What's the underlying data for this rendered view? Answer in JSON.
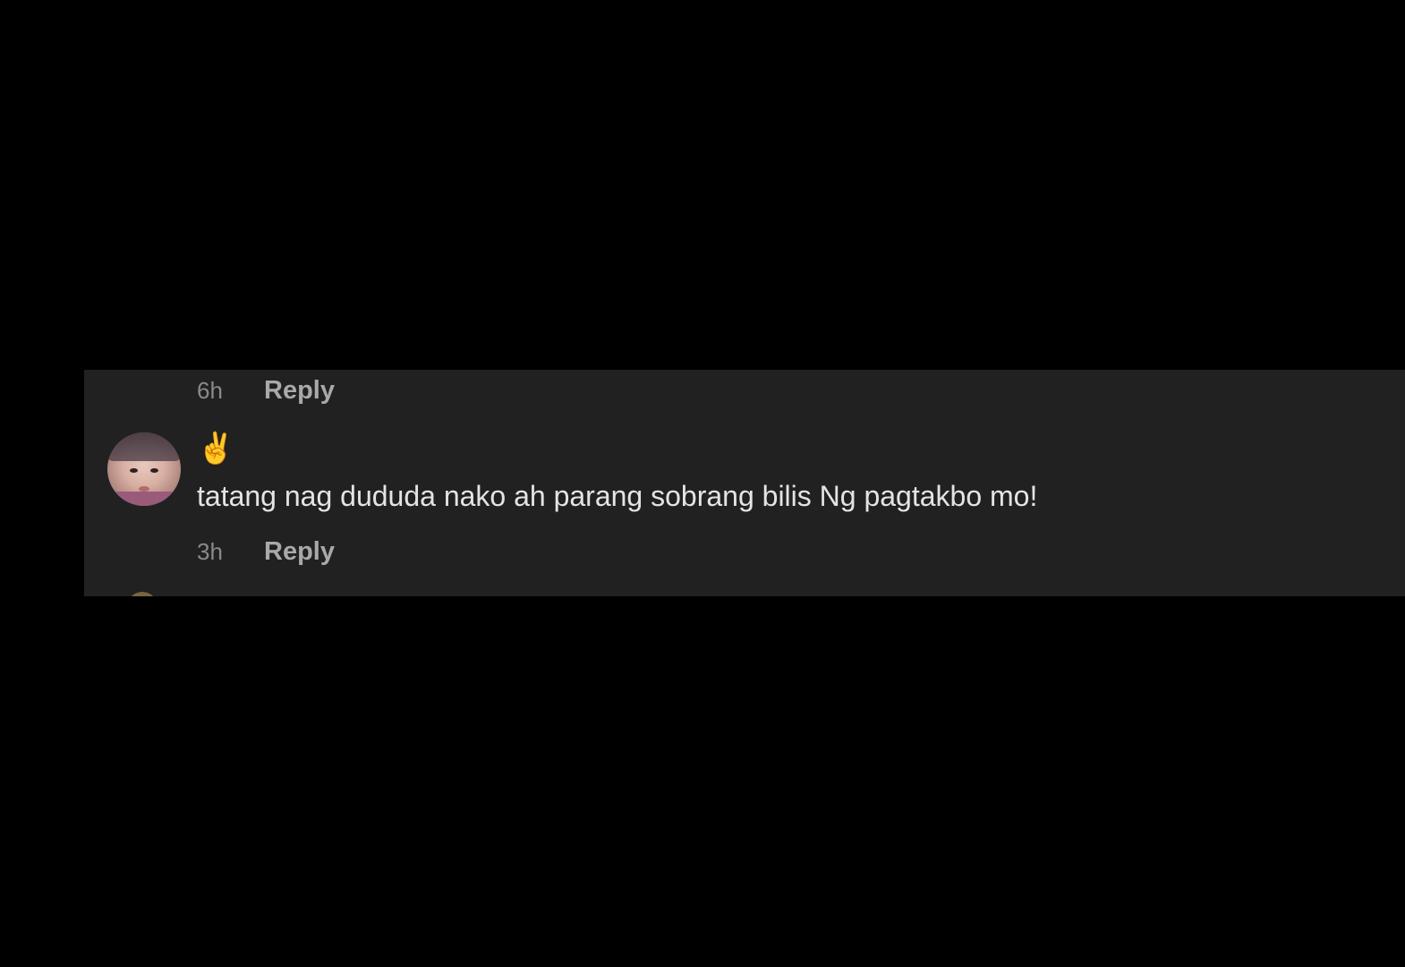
{
  "comments": {
    "previous": {
      "timestamp": "6h",
      "reply_label": "Reply"
    },
    "current": {
      "emoji": "✌️",
      "text": "tatang nag dududa nako ah parang sobrang bilis Ng pagtakbo mo!",
      "timestamp": "3h",
      "reply_label": "Reply",
      "avatar_icon": "user-avatar-photo"
    }
  },
  "colors": {
    "background": "#000000",
    "panel": "#212121",
    "text": "#e4e4e4",
    "timestamp": "#8a8a8a",
    "reply": "#a9a9a9"
  }
}
